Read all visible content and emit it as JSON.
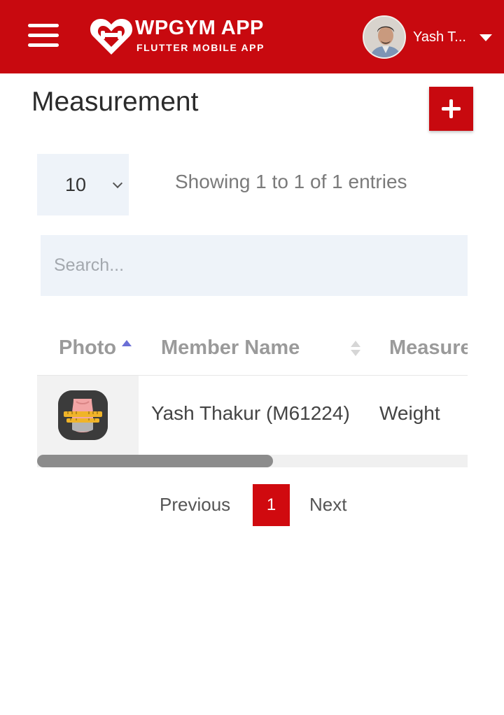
{
  "header": {
    "logo_title": "WPGYM APP",
    "logo_subtitle": "FLUTTER MOBILE APP",
    "user_name": "Yash T...",
    "brand_color": "#c8090f"
  },
  "page": {
    "title": "Measurement"
  },
  "table_controls": {
    "page_length": "10",
    "info": "Showing 1 to 1 of 1 entries",
    "search_placeholder": "Search..."
  },
  "table": {
    "columns": [
      "Photo",
      "Member Name",
      "Measure"
    ],
    "rows": [
      {
        "photo": "measurement-thumbnail",
        "member_name": "Yash Thakur (M61224)",
        "measurement": "Weight"
      }
    ]
  },
  "pagination": {
    "previous_label": "Previous",
    "current_page": "1",
    "next_label": "Next"
  }
}
